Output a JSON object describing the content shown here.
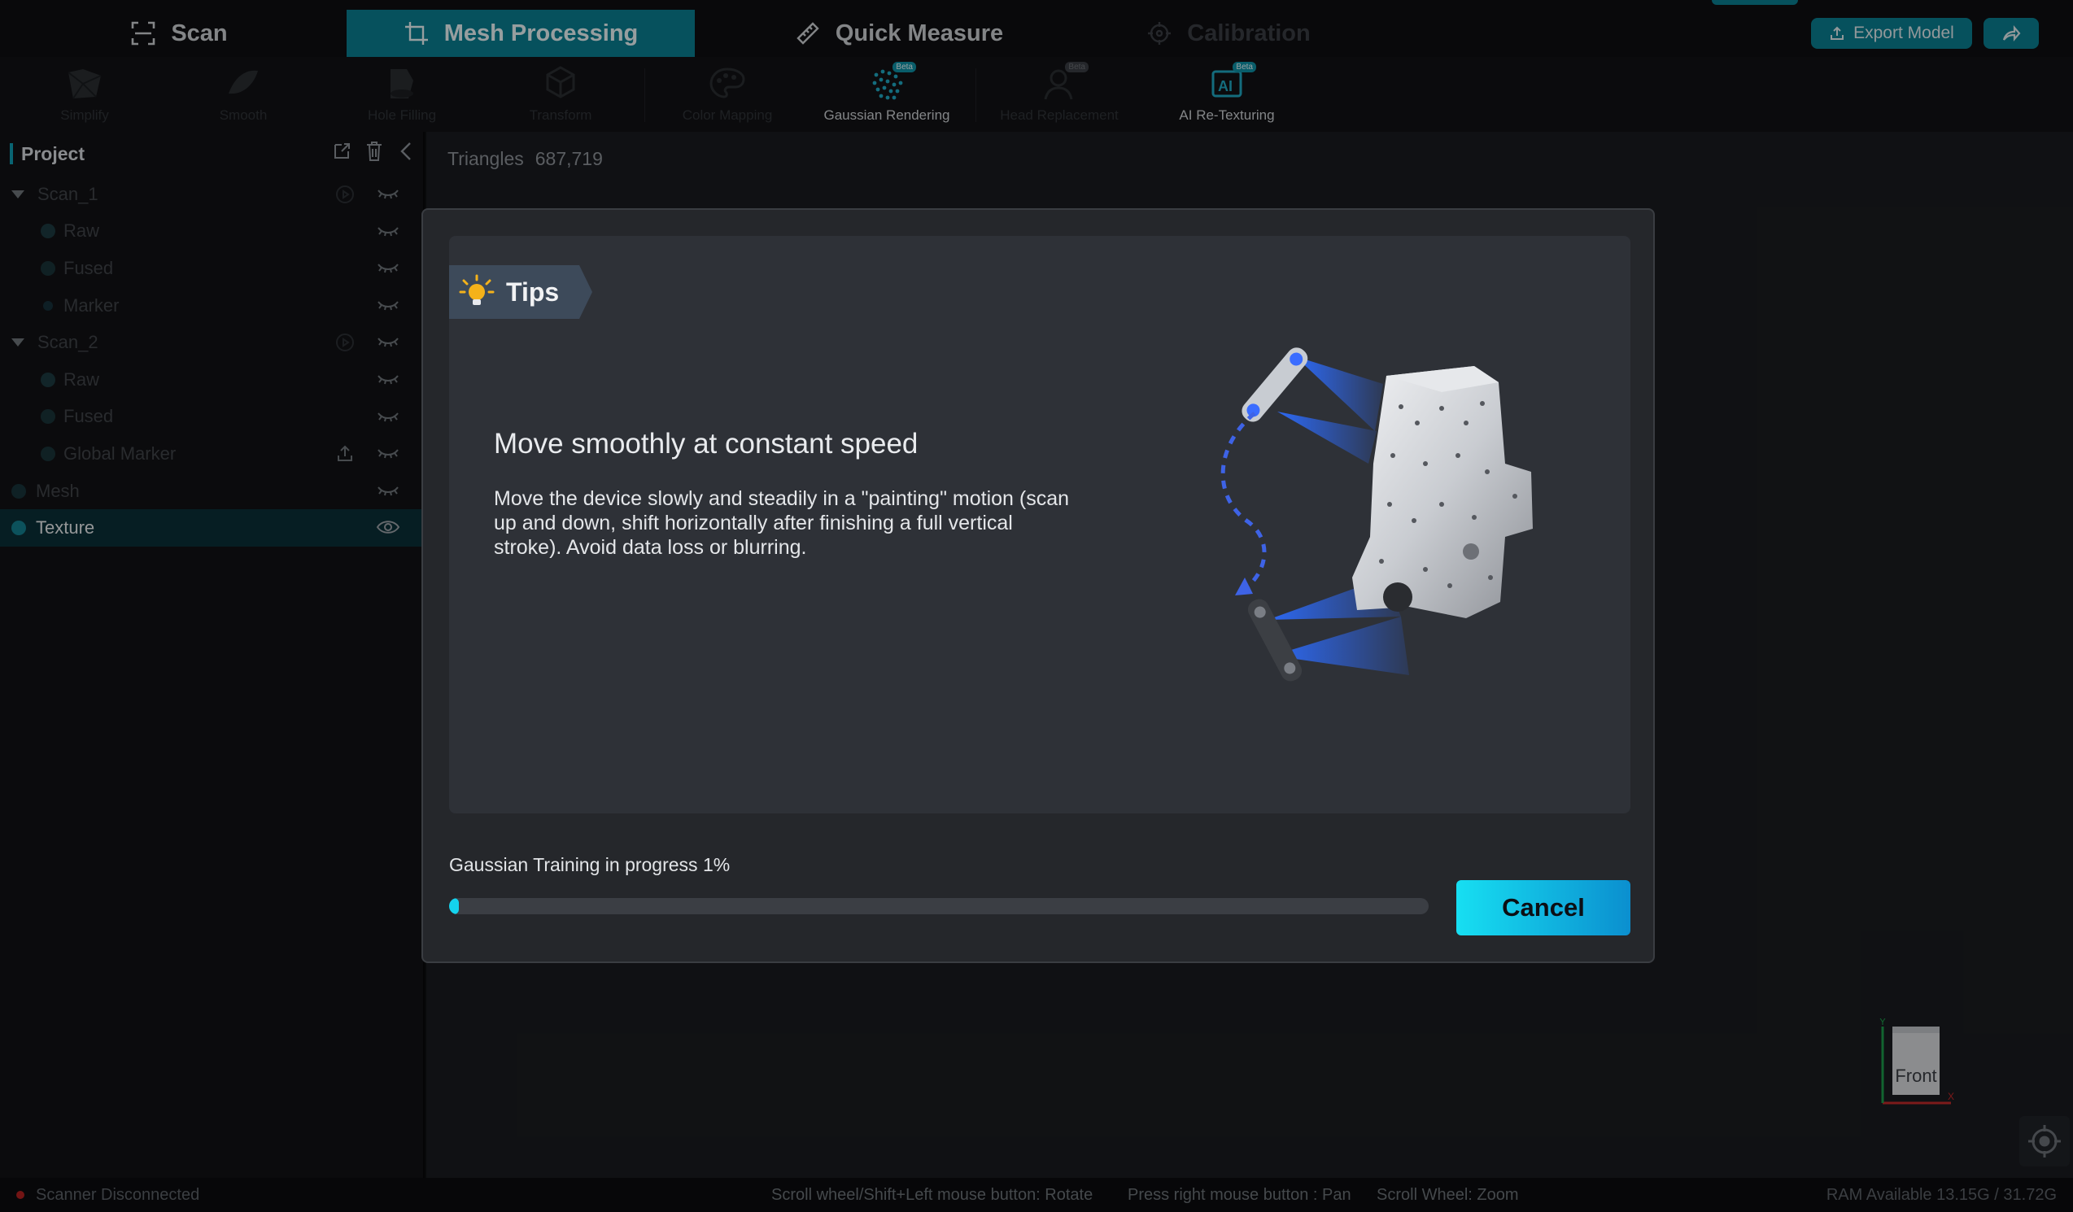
{
  "nav": {
    "tabs": [
      {
        "label": "Scan",
        "icon": "scan-icon"
      },
      {
        "label": "Mesh Processing",
        "icon": "mesh-processing-icon",
        "active": true
      },
      {
        "label": "Quick Measure",
        "icon": "ruler-icon"
      },
      {
        "label": "Calibration",
        "icon": "calibration-icon",
        "disabled": true
      }
    ],
    "export_label": "Export Model",
    "share_icon": "share-icon"
  },
  "toolbar": {
    "tools": [
      {
        "label": "Simplify",
        "enabled": false
      },
      {
        "label": "Smooth",
        "enabled": false
      },
      {
        "label": "Hole Filling",
        "enabled": false
      },
      {
        "label": "Transform",
        "enabled": false
      },
      {
        "label": "Color Mapping",
        "enabled": false
      },
      {
        "label": "Gaussian Rendering",
        "enabled": true,
        "beta": "Beta"
      },
      {
        "label": "Head Replacement",
        "enabled": false,
        "beta": "Beta"
      },
      {
        "label": "AI Re-Texturing",
        "enabled": true,
        "beta": "Beta"
      }
    ]
  },
  "project": {
    "title": "Project",
    "tree": [
      {
        "label": "Scan_1",
        "level": 0
      },
      {
        "label": "Raw",
        "level": 1
      },
      {
        "label": "Fused",
        "level": 1
      },
      {
        "label": "Marker",
        "level": 1
      },
      {
        "label": "Scan_2",
        "level": 0
      },
      {
        "label": "Raw",
        "level": 1
      },
      {
        "label": "Fused",
        "level": 1
      },
      {
        "label": "Global Marker",
        "level": 1
      },
      {
        "label": "Mesh",
        "level": 0
      },
      {
        "label": "Texture",
        "level": 0,
        "selected": true
      }
    ]
  },
  "viewport": {
    "triangles_label": "Triangles",
    "triangles_value": "687,719",
    "view_cube_label": "Front",
    "axis_x": "X",
    "axis_y": "Y"
  },
  "dialog": {
    "tips_label": "Tips",
    "tip_title": "Move smoothly at constant speed",
    "tip_body": "Move the device slowly and steadily in a \"painting\" motion (scan up and down, shift horizontally after finishing a full vertical stroke). Avoid data loss or blurring.",
    "progress_label": "Gaussian Training in progress 1%",
    "progress_fraction": 0.01,
    "cancel_label": "Cancel"
  },
  "status": {
    "scanner": "Scanner Disconnected",
    "hint_rotate": "Scroll wheel/Shift+Left mouse button: Rotate",
    "hint_pan": "Press right mouse button : Pan",
    "hint_zoom": "Scroll Wheel: Zoom",
    "ram": "RAM Available 13.15G / 31.72G"
  },
  "colors": {
    "accent": "#0a7d8f",
    "progress": "#14d3ee",
    "disconnected": "#b02020"
  }
}
